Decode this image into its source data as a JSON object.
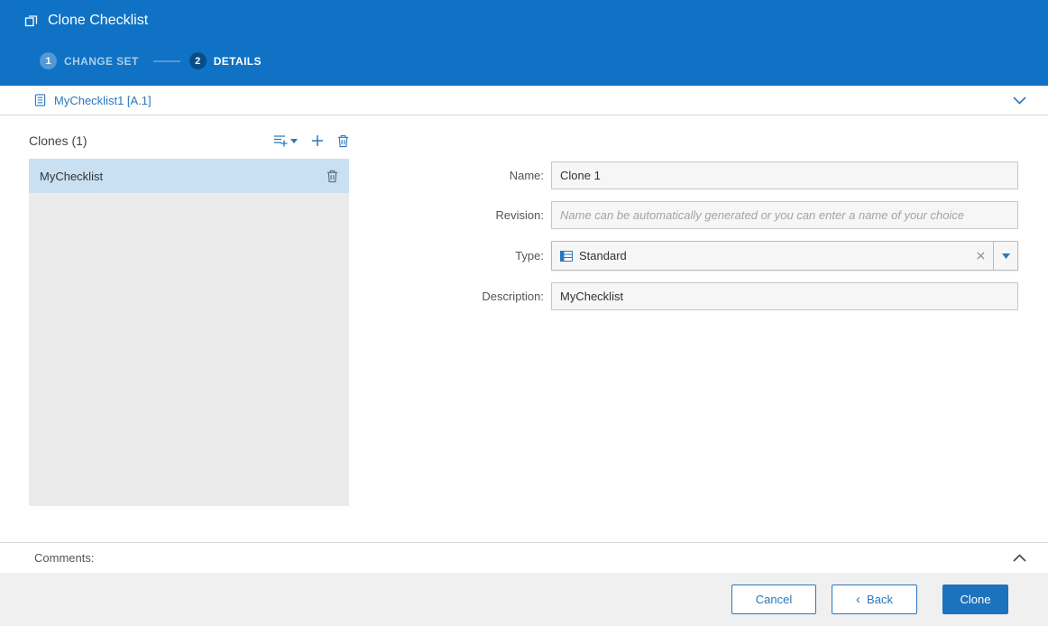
{
  "header": {
    "title": "Clone Checklist",
    "steps": [
      {
        "number": "1",
        "label": "CHANGE SET"
      },
      {
        "number": "2",
        "label": "DETAILS"
      }
    ]
  },
  "subheader": {
    "title": "MyChecklist1 [A.1]"
  },
  "clones_panel": {
    "title": "Clones (1)",
    "items": [
      {
        "name": "MyChecklist",
        "selected": true
      }
    ]
  },
  "form": {
    "name": {
      "label": "Name:",
      "value": "Clone 1"
    },
    "revision": {
      "label": "Revision:",
      "value": "",
      "placeholder": "Name can be automatically generated or you can enter a name of your choice"
    },
    "type": {
      "label": "Type:",
      "value": "Standard"
    },
    "description": {
      "label": "Description:",
      "value": "MyChecklist"
    }
  },
  "comments": {
    "label": "Comments:"
  },
  "footer": {
    "cancel_label": "Cancel",
    "back_chevron": "‹",
    "back_label": "Back",
    "clone_label": "Clone"
  },
  "icons": {
    "clone-icon": "two overlapping squares",
    "checklist-icon": "document with list lines",
    "add-sorted-icon": "list lines with plus and caret",
    "plus-icon": "plus",
    "trash-icon": "trash can",
    "chevron-down-icon": "chevron down",
    "chevron-up-icon": "chevron up",
    "table-type-icon": "blue table grid",
    "clear-x-icon": "x",
    "dropdown-caret-icon": "filled triangle down"
  },
  "colors": {
    "header_blue": "#0f72c4",
    "accent_blue": "#2a77bc",
    "active_step": "#0a4d85",
    "selection_blue": "#c9e0f3",
    "primary_button": "#1b72bd",
    "list_bg": "#ebebeb",
    "footer_bg": "#f0f0f0"
  }
}
